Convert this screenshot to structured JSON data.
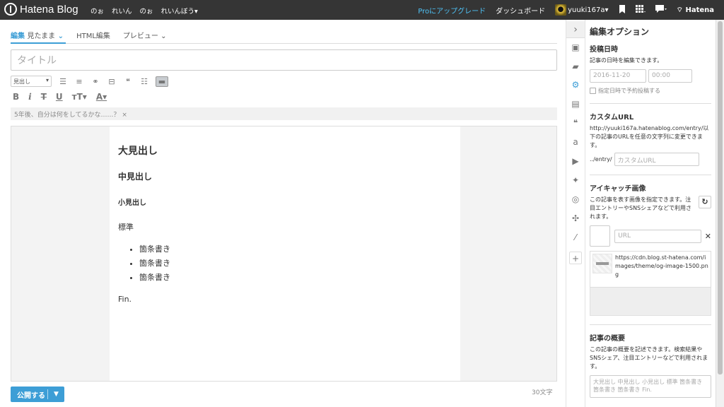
{
  "topbar": {
    "logo_text": "Hatena Blog",
    "nav": [
      "のぉ",
      "れいん",
      "のぉ",
      "れいんぼう▾"
    ],
    "pro_upgrade": "Proにアップグレード",
    "dashboard": "ダッシュボード",
    "username": "yuuki167a",
    "user_caret": "▾",
    "hatena_label": "Hatena"
  },
  "editor": {
    "tabs": [
      {
        "label": "編集",
        "sub": "見たまま",
        "caret": "⌄"
      },
      {
        "label": "HTML編集"
      },
      {
        "label": "プレビュー",
        "caret": "⌄"
      }
    ],
    "title_placeholder": "タイトル",
    "format_select": "見出し",
    "hint": "5年後、自分は何をしてるかな……？ ×",
    "content": {
      "h1": "大見出し",
      "h2": "中見出し",
      "h3": "小見出し",
      "normal": "標準",
      "bullets": [
        "箇条書き",
        "箇条書き",
        "箇条書き"
      ],
      "closing": "Fin."
    },
    "publish_label": "公開する",
    "char_count": "30文字"
  },
  "sidepanel": {
    "title": "編集オプション",
    "post_date": {
      "heading": "投稿日時",
      "description": "記事の日時を編集できます。",
      "date_placeholder": "2016-11-20",
      "time_placeholder": "00:00",
      "schedule_label": "指定日時で予約投稿する"
    },
    "custom_url": {
      "heading": "カスタムURL",
      "description": "http://yuuki167a.hatenablog.com/entry/以下の記事のURLを任意の文字列に変更できます。",
      "prefix": "../entry/",
      "placeholder": "カスタムURL"
    },
    "eyecatch": {
      "heading": "アイキャッチ画像",
      "description": "この記事を表す画像を指定できます。注目エントリーやSNSシェアなどで利用されます。",
      "url_placeholder": "URL",
      "og_url": "https://cdn.blog.st-hatena.com/images/theme/og-image-1500.png"
    },
    "summary": {
      "heading": "記事の概要",
      "description": "この記事の概要を記述できます。検索結果やSNSシェア、注目エントリーなどで利用されます。",
      "placeholder": "大見出し 中見出し 小見出し 標準 箇条書き 箇条書き 箇条書き Fin."
    }
  }
}
